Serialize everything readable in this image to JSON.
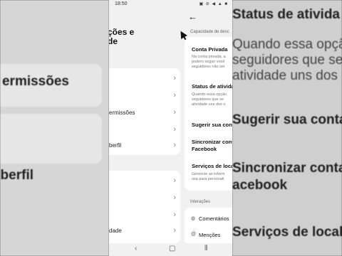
{
  "background_left": {
    "texts": [
      "ermissões",
      "berfil"
    ]
  },
  "background_right": {
    "texts": [
      "Status de ativida",
      "Quando essa opção",
      "seguidores que seg",
      "atividade uns dos o",
      "Sugerir sua conta",
      "Sincronizar conta",
      "acebook",
      "Serviços de locali"
    ]
  },
  "status_bar": {
    "time": "18:50",
    "icons": "▣ ⊘ ◀ ▲ ■"
  },
  "left_page": {
    "title_line1": "ções e",
    "title_line2": "de",
    "items_group1": [
      {
        "label": ""
      },
      {
        "label": ""
      },
      {
        "label": "ermissões"
      },
      {
        "label": ""
      },
      {
        "label": "berfil"
      }
    ],
    "items_group2": [
      {
        "label": ""
      },
      {
        "label": ""
      },
      {
        "label": ""
      },
      {
        "label": "dade"
      }
    ]
  },
  "right_page": {
    "back_icon": "back-arrow",
    "section_privacy": "Capacidade de desc",
    "items": [
      {
        "title": "Conta Privada",
        "desc": [
          "Na conta privada, a",
          "podem seguir você",
          "seguidores não ser"
        ]
      },
      {
        "title": "Status de ativida",
        "desc": [
          "Quando essa opção",
          "seguidores que se",
          "atividade uns dos o"
        ]
      },
      {
        "title": "Sugerir sua conta",
        "desc": []
      },
      {
        "title": "Sincronizar conta",
        "title2": "Facebook",
        "desc": []
      },
      {
        "title": "Serviços de loca",
        "desc": [
          "Gerencie as inform",
          "usa para personali"
        ]
      }
    ],
    "section_interactions": "Interações",
    "interactions": [
      {
        "icon": "comment-icon",
        "label": "Comentários"
      },
      {
        "icon": "mention-icon",
        "label": "Menções"
      }
    ]
  },
  "navbar": {
    "back": "‹",
    "home": "▢",
    "recents": "⦀"
  }
}
